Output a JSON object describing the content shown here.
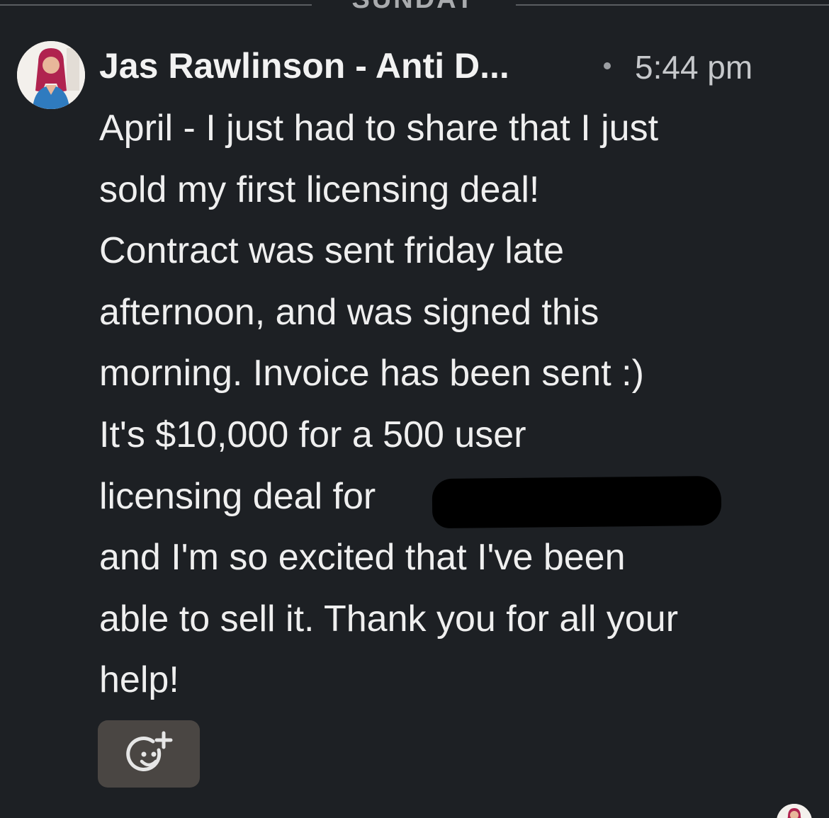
{
  "day_divider": {
    "label": "SUNDAY"
  },
  "message": {
    "sender": "Jas Rawlinson - Anti D...",
    "time": "5:44 pm",
    "lines": [
      "April - I just had to share that I just",
      "sold my first licensing deal!",
      "Contract was sent friday late",
      "afternoon, and was signed this",
      "morning. Invoice has been sent :)",
      "It's $10,000 for a 500 user",
      "licensing deal for",
      "and I'm so excited that I've been",
      "able to sell it. Thank you for all your",
      "help!"
    ],
    "redacted_after_line": 6
  },
  "icons": {
    "avatar": "avatar-photo",
    "react": "add-reaction-icon"
  },
  "colors": {
    "background": "#1d2024",
    "text": "#efefef",
    "divider": "#5a5d61",
    "react_button_bg": "#4a4643",
    "redaction": "#000000"
  }
}
